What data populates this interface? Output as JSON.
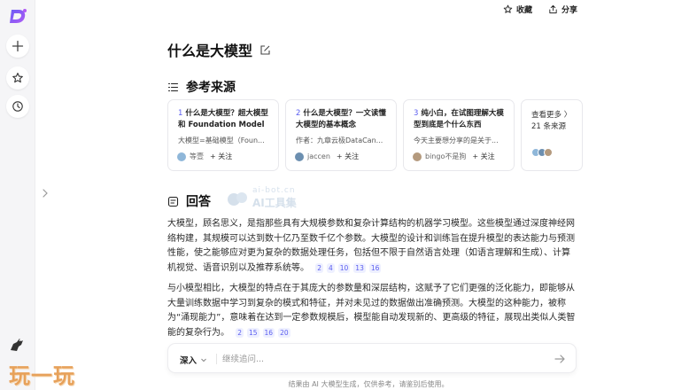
{
  "app": {
    "accent": "#5b5ef0",
    "logo_letter": "D"
  },
  "topbar": {
    "collect_label": "收藏",
    "share_label": "分享"
  },
  "page": {
    "title": "什么是大模型"
  },
  "sources_section": {
    "title": "参考来源",
    "cards": [
      {
        "num": "1",
        "title": "什么是大模型？超大模型和 Foundation Model ...",
        "desc": "大模型=基础模型（Foun...",
        "author": "等壹",
        "follow": "+ 关注",
        "avatar_color": "#8fb7d9"
      },
      {
        "num": "2",
        "title": "什么是大模型？一文读懂大模型的基本概念",
        "desc": "作者：九章云极DataCan...",
        "author": "jaccen",
        "follow": "+ 关注",
        "avatar_color": "#6c8fb0"
      },
      {
        "num": "3",
        "title": "纯小白，在试图理解大模型到底是个什么东西",
        "desc": "今天主要想分享的是关于...",
        "author": "bingo不是狗",
        "follow": "+ 关注",
        "avatar_color": "#b49a7e"
      }
    ],
    "more": {
      "line1": "查看更多 〉",
      "line2": "21 条来源"
    }
  },
  "answer_section": {
    "title": "回答",
    "watermark_top": "ai-bot.cn",
    "watermark_bottom": "AI工具集",
    "paragraphs": [
      {
        "text": "大模型，顾名思义，是指那些具有大规模参数和复杂计算结构的机器学习模型。这些模型通过深度神经网络构建，其规模可以达到数十亿乃至数千亿个参数。大模型的设计和训练旨在提升模型的表达能力与预测性能，使之能够应对更为复杂的数据处理任务，包括但不限于自然语言处理（如语言理解和生成）、计算机视觉、语音识别以及推荐系统等。",
        "cites": [
          "2",
          "4",
          "10",
          "13",
          "16"
        ]
      },
      {
        "text": "与小模型相比，大模型的特点在于其庞大的参数量和深层结构，这赋予了它们更强的泛化能力，即能够从大量训练数据中学习到复杂的模式和特征，并对未见过的数据做出准确预测。大模型的这种能力，被称为“涌现能力”，意味着在达到一定参数规模后，模型能自动发现新的、更高级的特征，展现出类似人类智能的复杂行为。",
        "cites": [
          "2",
          "15",
          "16",
          "20"
        ]
      }
    ]
  },
  "input": {
    "mode_label": "深入",
    "placeholder": "继续追问..."
  },
  "footer": {
    "disclaimer": "结果由 AI 大模型生成，仅供参考，请鉴别后使用。"
  },
  "overlay_watermark": {
    "text": "玩一玩"
  }
}
